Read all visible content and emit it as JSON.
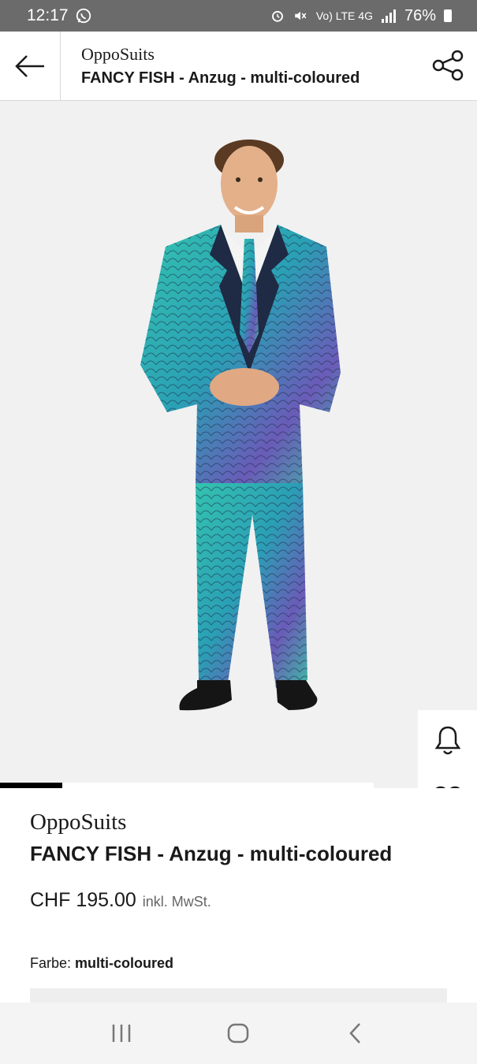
{
  "status_bar": {
    "time": "12:17",
    "network": "Vo) LTE 4G",
    "battery": "76%"
  },
  "header": {
    "brand": "OppoSuits",
    "title": "FANCY FISH - Anzug - multi-coloured"
  },
  "product": {
    "brand": "OppoSuits",
    "title": "FANCY FISH - Anzug - multi-coloured",
    "price": "CHF 195.00",
    "tax_note": "inkl. MwSt.",
    "color_label": "Farbe:",
    "color_value": "multi-coloured"
  },
  "image_gallery": {
    "progress_fraction": 0.167
  },
  "icons": {
    "back": "arrow-left-icon",
    "share": "share-icon",
    "notify": "bell-icon",
    "wishlist": "heart-icon",
    "bag": "shopping-bag-icon",
    "ar": "sparkle-frame-icon"
  },
  "colors": {
    "status_bar_bg": "#6b6b6b",
    "image_bg": "#f1f1f1",
    "suit_teal": "#2fb3a8",
    "suit_purple": "#6a5bb8",
    "black": "#000000"
  }
}
